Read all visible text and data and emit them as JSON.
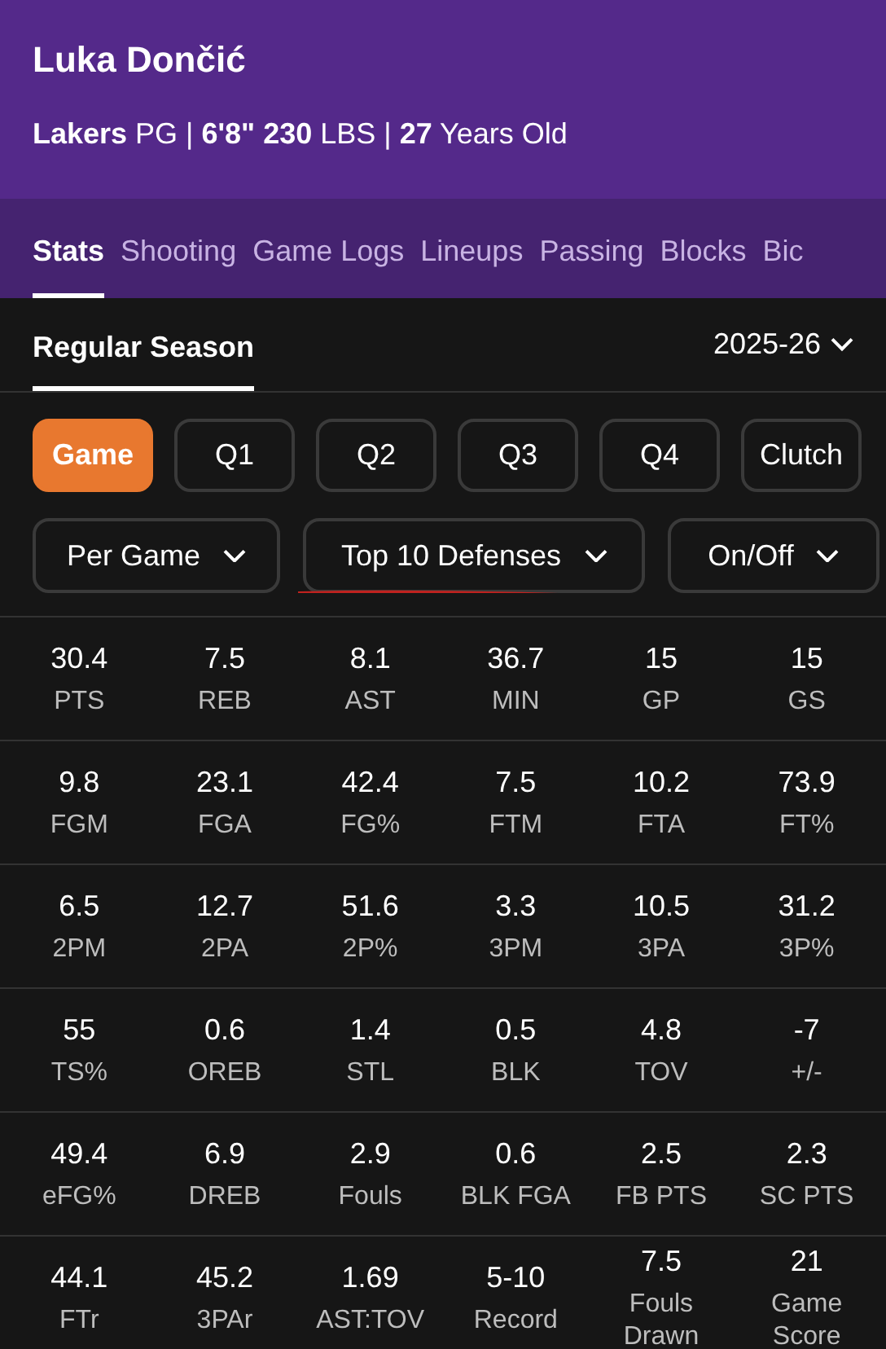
{
  "player": {
    "name": "Luka Dončić",
    "subtitle": "**Lakers** PG | **6'8\" 230** LBS | **27** Years Old"
  },
  "tabs": [
    {
      "label": "Stats",
      "selected": true
    },
    {
      "label": "Shooting",
      "selected": false
    },
    {
      "label": "Game Logs",
      "selected": false
    },
    {
      "label": "Lineups",
      "selected": false
    },
    {
      "label": "Passing",
      "selected": false
    },
    {
      "label": "Blocks",
      "selected": false
    },
    {
      "label": "Bic",
      "selected": false
    }
  ],
  "section": {
    "label": "Regular Season",
    "selected": true
  },
  "season_select": {
    "value": "2025-26"
  },
  "periods": [
    {
      "label": "Game",
      "selected": true
    },
    {
      "label": "Q1",
      "selected": false
    },
    {
      "label": "Q2",
      "selected": false
    },
    {
      "label": "Q3",
      "selected": false
    },
    {
      "label": "Q4",
      "selected": false
    },
    {
      "label": "Clutch",
      "selected": false
    }
  ],
  "filters": [
    {
      "value": "Per Game",
      "underlined": false
    },
    {
      "value": "Top 10 Defenses",
      "underlined": true
    },
    {
      "value": "On/Off",
      "underlined": false
    }
  ],
  "stat_rows": [
    [
      {
        "value": "30.4",
        "label": "PTS"
      },
      {
        "value": "7.5",
        "label": "REB"
      },
      {
        "value": "8.1",
        "label": "AST"
      },
      {
        "value": "36.7",
        "label": "MIN"
      },
      {
        "value": "15",
        "label": "GP"
      },
      {
        "value": "15",
        "label": "GS"
      }
    ],
    [
      {
        "value": "9.8",
        "label": "FGM"
      },
      {
        "value": "23.1",
        "label": "FGA"
      },
      {
        "value": "42.4",
        "label": "FG%"
      },
      {
        "value": "7.5",
        "label": "FTM"
      },
      {
        "value": "10.2",
        "label": "FTA"
      },
      {
        "value": "73.9",
        "label": "FT%"
      }
    ],
    [
      {
        "value": "6.5",
        "label": "2PM"
      },
      {
        "value": "12.7",
        "label": "2PA"
      },
      {
        "value": "51.6",
        "label": "2P%"
      },
      {
        "value": "3.3",
        "label": "3PM"
      },
      {
        "value": "10.5",
        "label": "3PA"
      },
      {
        "value": "31.2",
        "label": "3P%"
      }
    ],
    [
      {
        "value": "55",
        "label": "TS%"
      },
      {
        "value": "0.6",
        "label": "OREB"
      },
      {
        "value": "1.4",
        "label": "STL"
      },
      {
        "value": "0.5",
        "label": "BLK"
      },
      {
        "value": "4.8",
        "label": "TOV"
      },
      {
        "value": "-7",
        "label": "+/-"
      }
    ],
    [
      {
        "value": "49.4",
        "label": "eFG%"
      },
      {
        "value": "6.9",
        "label": "DREB"
      },
      {
        "value": "2.9",
        "label": "Fouls"
      },
      {
        "value": "0.6",
        "label": "BLK FGA"
      },
      {
        "value": "2.5",
        "label": "FB PTS"
      },
      {
        "value": "2.3",
        "label": "SC PTS"
      }
    ],
    [
      {
        "value": "44.1",
        "label": "FTr"
      },
      {
        "value": "45.2",
        "label": "3PAr"
      },
      {
        "value": "1.69",
        "label": "AST:TOV"
      },
      {
        "value": "5-10",
        "label": "Record"
      },
      {
        "value": "7.5",
        "label": "Fouls Drawn"
      },
      {
        "value": "21",
        "label": "Game Score"
      }
    ]
  ]
}
